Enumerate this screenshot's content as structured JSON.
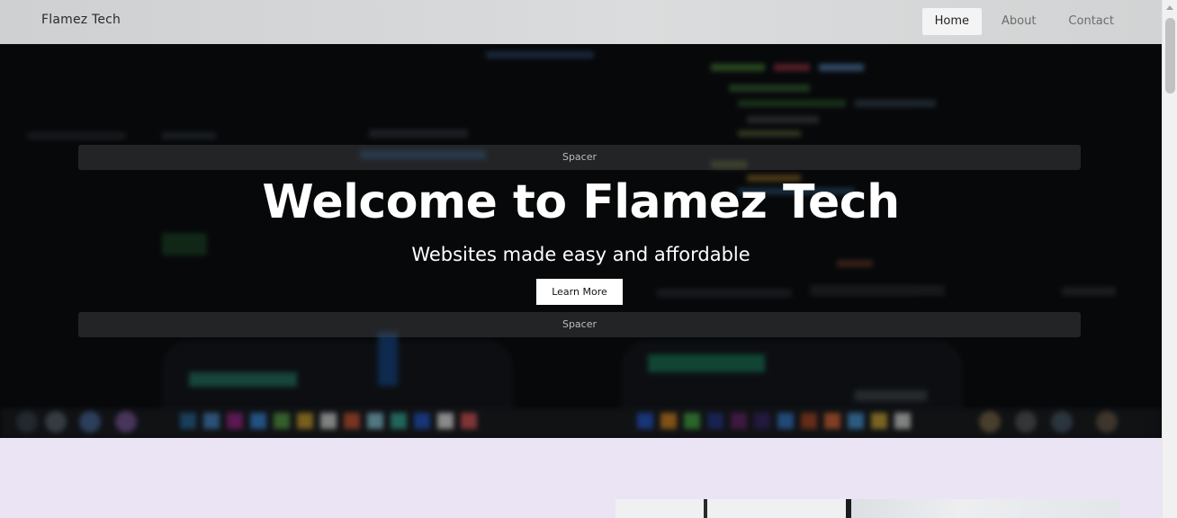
{
  "nav": {
    "brand": "Flamez Tech",
    "links": [
      {
        "label": "Home",
        "active": true
      },
      {
        "label": "About",
        "active": false
      },
      {
        "label": "Contact",
        "active": false
      }
    ]
  },
  "hero": {
    "spacer_top": "Spacer",
    "title": "Welcome to Flamez Tech",
    "subtitle": "Websites made easy and affordable",
    "button": "Learn More",
    "spacer_bottom": "Spacer"
  },
  "colors": {
    "lower_section_bg": "#ebe4f4",
    "hero_text": "#ffffff",
    "nav_active_bg": "#f4f4f4"
  }
}
